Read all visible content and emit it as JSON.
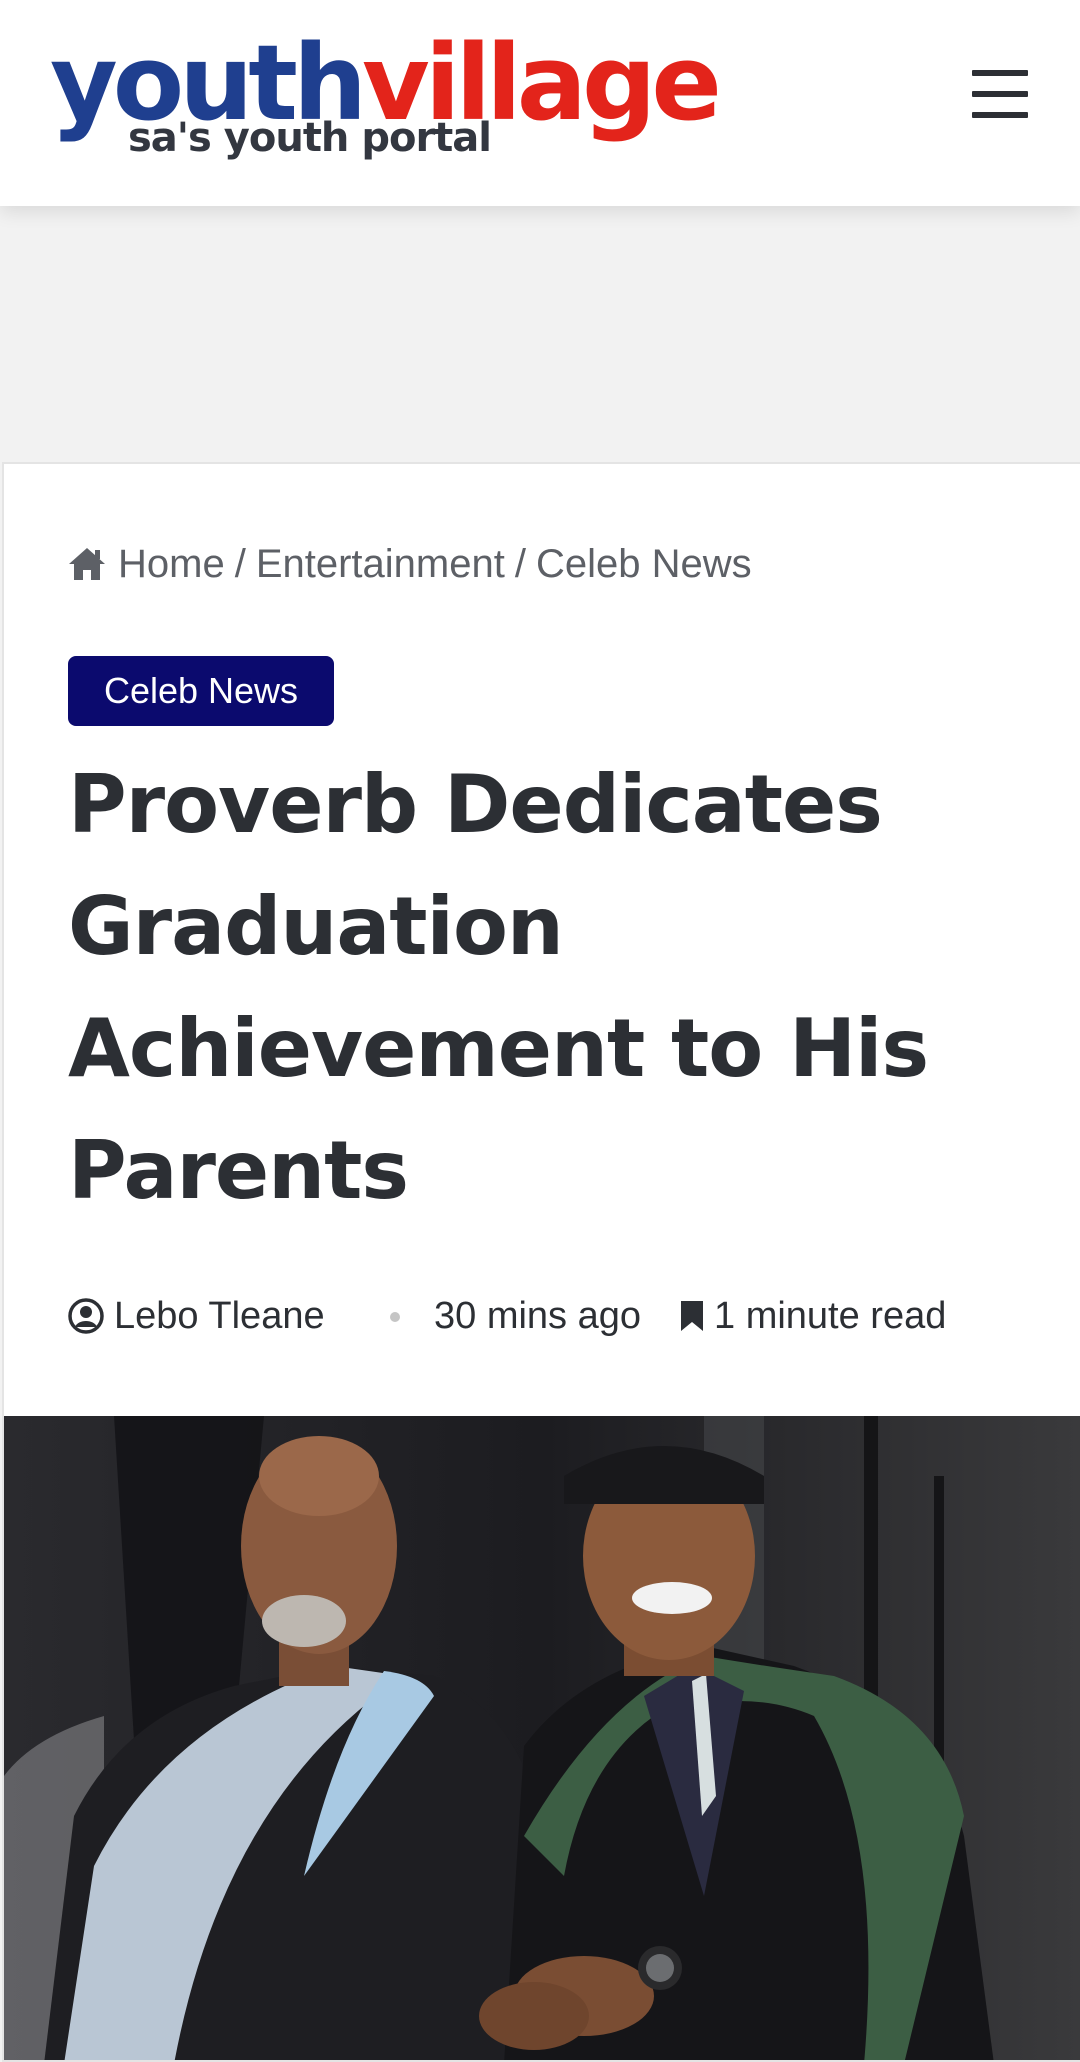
{
  "header": {
    "logo": {
      "word_part1": "youth",
      "word_part2": "village",
      "tagline": "sa's youth portal",
      "color_primary": "#1f3f8f",
      "color_accent": "#e3241b"
    },
    "menu_icon": "hamburger-menu-icon"
  },
  "breadcrumb": {
    "home_icon": "home-icon",
    "items": [
      "Home",
      "Entertainment",
      "Celeb News"
    ],
    "separator": "/"
  },
  "article": {
    "category": "Celeb News",
    "category_color": "#0b0a6e",
    "title": "Proverb Dedicates Graduation Achievement to His Parents",
    "author": "Lebo Tleane",
    "author_icon": "user-circle-icon",
    "time_ago": "30 mins ago",
    "read_time": "1 minute read",
    "read_icon": "bookmark-icon"
  }
}
